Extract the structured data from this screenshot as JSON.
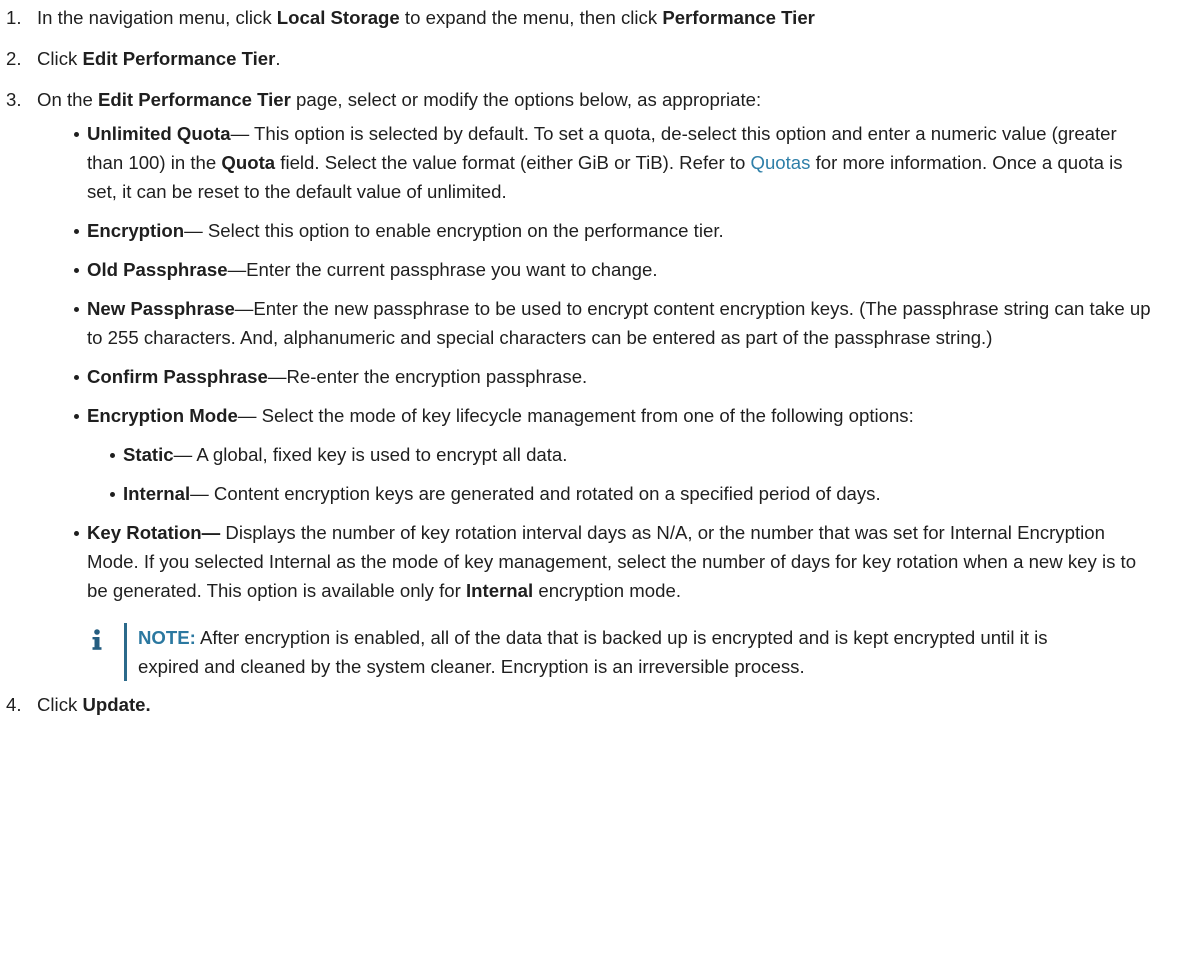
{
  "steps": [
    {
      "num": "1.",
      "pre": "In the navigation menu, click ",
      "b1": "Local Storage",
      "mid": " to expand the menu, then click ",
      "b2": "Performance Tier"
    },
    {
      "num": "2.",
      "pre": "Click ",
      "b1": "Edit Performance Tier",
      "post": "."
    },
    {
      "num": "3.",
      "pre": "On the ",
      "b1": "Edit Performance Tier",
      "post": " page, select or modify the options below, as appropriate:"
    },
    {
      "num": "4.",
      "pre": "Click ",
      "b1": "Update."
    }
  ],
  "options": {
    "unlimited_quota": {
      "term": "Unlimited Quota",
      "t1": "— This option is selected by default. To set a quota, de-select this option and enter a numeric value (greater than 100) in the ",
      "quota": "Quota",
      "t2": " field. Select the value format (either GiB or TiB). Refer to ",
      "link": "Quotas",
      "t3": " for more information. Once a quota is set, it can be reset to the default value of unlimited."
    },
    "encryption": {
      "term": "Encryption",
      "text": "— Select this option to enable encryption on the performance tier."
    },
    "old_passphrase": {
      "term": "Old Passphrase",
      "text": "—Enter the current passphrase you want to change."
    },
    "new_passphrase": {
      "term": "New Passphrase",
      "text": "—Enter the new passphrase to be used to encrypt content encryption keys. (The passphrase string can take up to 255 characters. And, alphanumeric and special characters can be entered as part of the passphrase string.)"
    },
    "confirm_passphrase": {
      "term": "Confirm Passphrase",
      "text": "—Re-enter the encryption passphrase."
    },
    "encryption_mode": {
      "term": "Encryption Mode",
      "text": "— Select the mode of key lifecycle management from one of the following options:",
      "sub": [
        {
          "term": "Static",
          "text": "— A global, fixed key is used to encrypt all data."
        },
        {
          "term": "Internal",
          "text": "— Content encryption keys are generated and rotated on a specified period of days."
        }
      ]
    },
    "key_rotation": {
      "term": "Key Rotation—",
      "t1": " Displays the number of key rotation interval days as N/A, or the number that was set for Internal Encryption Mode. If you selected Internal as the mode of key management, select the number of days for key rotation when a new key is to be generated. This option is available only for ",
      "b": "Internal",
      "t2": " encryption mode."
    }
  },
  "note": {
    "icon": "info-icon",
    "label": "NOTE:",
    "text": " After encryption is enabled, all of the data that is backed up is encrypted and is kept encrypted until it is expired and cleaned by the system cleaner. Encryption is an irreversible process."
  }
}
